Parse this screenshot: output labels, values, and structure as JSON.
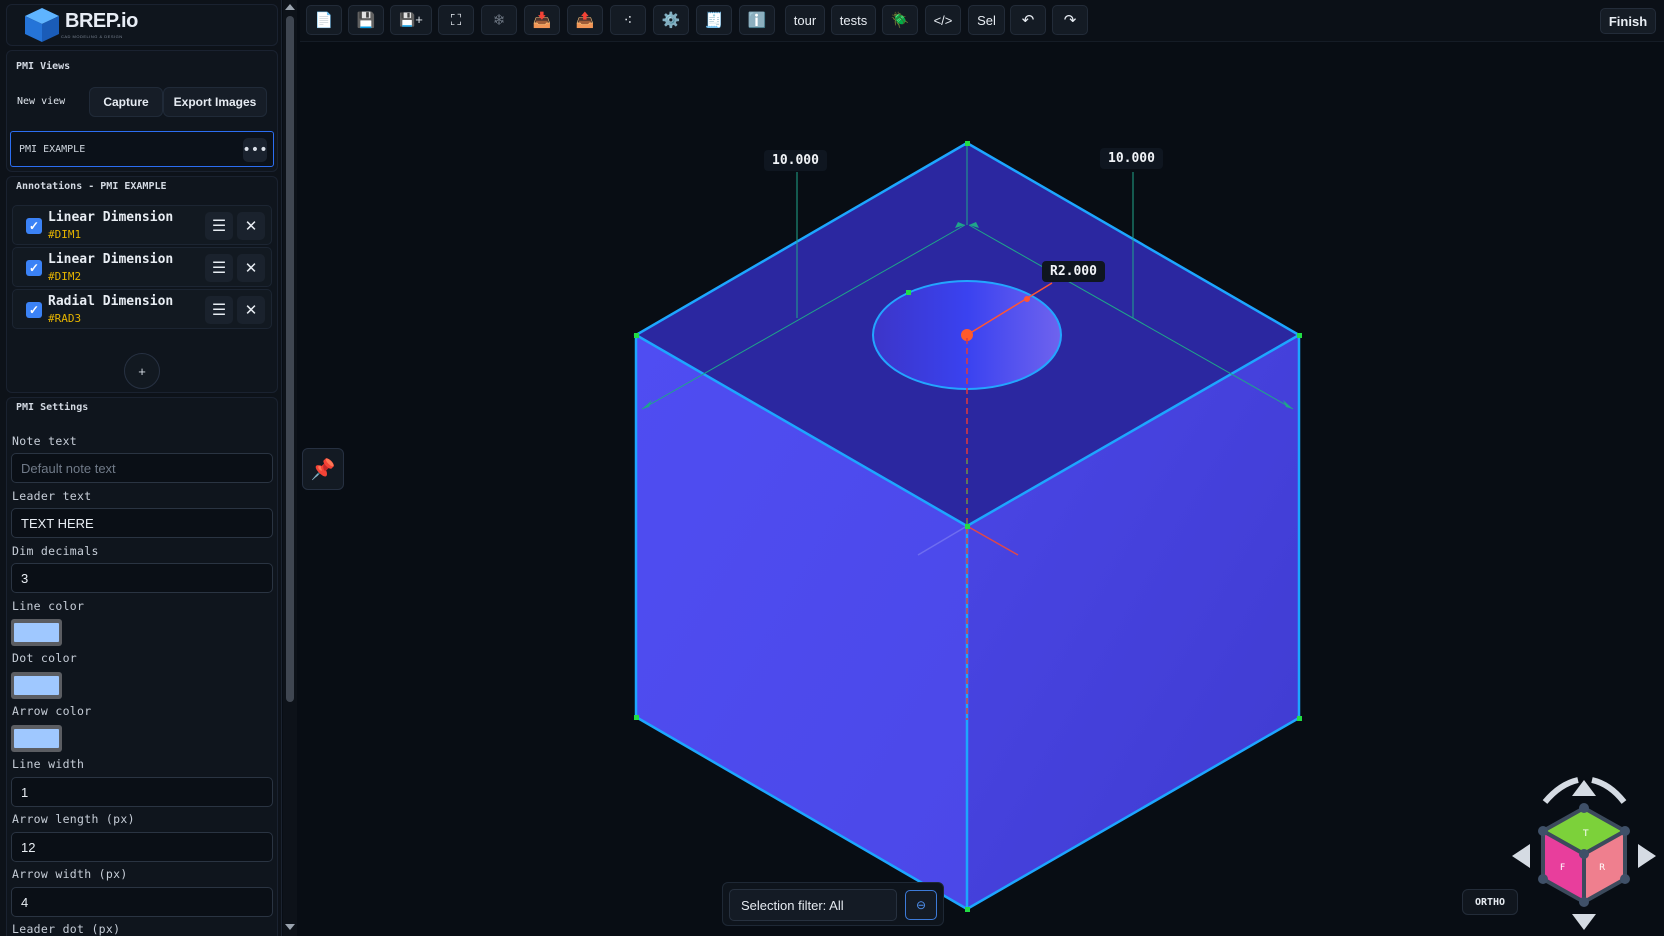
{
  "app": {
    "logo_text": "BREP.io",
    "logo_tagline": "CAD MODELING & DESIGN"
  },
  "pmi_views": {
    "title": "PMI Views",
    "new_view_label": "New view",
    "capture_label": "Capture",
    "export_label": "Export Images",
    "views": [
      {
        "name": "PMI EXAMPLE",
        "more": "•••"
      }
    ]
  },
  "annotations": {
    "title": "Annotations - PMI EXAMPLE",
    "items": [
      {
        "type": "Linear Dimension",
        "id": "#DIM1",
        "checked": true
      },
      {
        "type": "Linear Dimension",
        "id": "#DIM2",
        "checked": true
      },
      {
        "type": "Radial Dimension",
        "id": "#RAD3",
        "checked": true
      }
    ],
    "add_label": "+"
  },
  "pmi_settings": {
    "title": "PMI Settings",
    "note_text": {
      "label": "Note text",
      "placeholder": "Default note text",
      "value": ""
    },
    "leader_text": {
      "label": "Leader text",
      "value": "TEXT HERE"
    },
    "dim_decimals": {
      "label": "Dim decimals",
      "value": "3"
    },
    "line_color": {
      "label": "Line color",
      "value": "#9fc8ff"
    },
    "dot_color": {
      "label": "Dot color",
      "value": "#9fc8ff"
    },
    "arrow_color": {
      "label": "Arrow color",
      "value": "#9fc8ff"
    },
    "line_width": {
      "label": "Line width",
      "value": "1"
    },
    "arrow_length": {
      "label": "Arrow length (px)",
      "value": "12"
    },
    "arrow_width": {
      "label": "Arrow width (px)",
      "value": "4"
    },
    "leader_dot": {
      "label": "Leader dot (px)"
    }
  },
  "toolbar": {
    "icons": [
      "📄",
      "💾",
      "💾+",
      "⛶",
      "❄",
      "📥",
      "📤",
      "⁖",
      "⚙️",
      "🧾",
      "ℹ️"
    ],
    "tour_label": "tour",
    "tests_label": "tests",
    "bug_icon": "🪲",
    "code_label": "</>",
    "sel_label": "Sel",
    "undo_icon": "↶",
    "redo_icon": "↷",
    "finish_label": "Finish"
  },
  "viewport": {
    "dim_left": "10.000",
    "dim_right": "10.000",
    "dim_radius": "R2.000",
    "selection_filter": "Selection filter: All",
    "ortho_label": "ORTHO",
    "pin_icon": "📌"
  },
  "view_cube": {
    "top_label": "T",
    "front_label": "F",
    "right_label": "R"
  },
  "colors": {
    "accent": "#3b82f6",
    "annotation_id": "#e5b400",
    "part_face": "#4b4bef",
    "edge": "#22a8ff"
  }
}
